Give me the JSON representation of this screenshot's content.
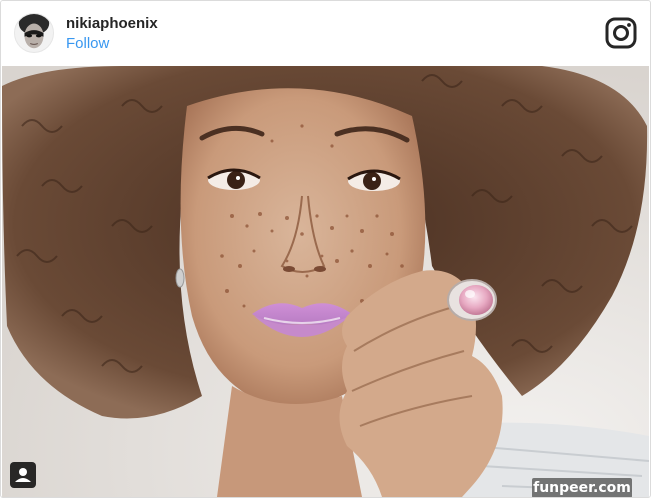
{
  "post": {
    "username": "nikiaphoenix",
    "follow_label": "Follow"
  },
  "icons": {
    "brand": "instagram-icon",
    "avatar": "profile-avatar",
    "tag": "tagged-user-icon"
  },
  "watermark": {
    "text": "funpeer.com"
  },
  "colors": {
    "follow_link": "#3897f0",
    "username": "#262626",
    "border": "#dbdbdb"
  }
}
